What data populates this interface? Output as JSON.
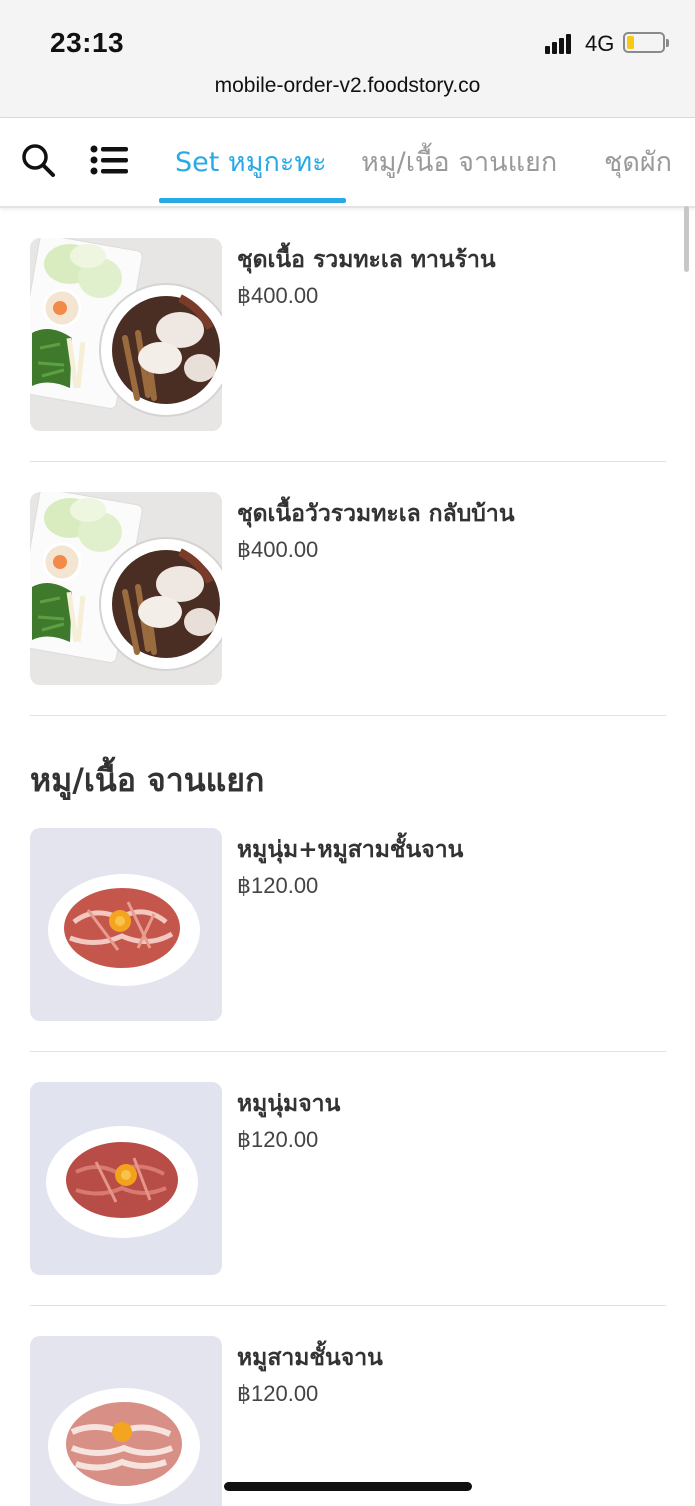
{
  "status": {
    "time": "23:13",
    "network": "4G",
    "battery_level": 0.22
  },
  "browser": {
    "url": "mobile-order-v2.foodstory.co"
  },
  "tabs": [
    {
      "label": "Set หมูกะทะ",
      "active": true
    },
    {
      "label": "หมู/เนื้อ จานแยก",
      "active": false
    },
    {
      "label": "ชุดผัก",
      "active": false
    }
  ],
  "accent_color": "#29a9e6",
  "sections": [
    {
      "title": "",
      "items": [
        {
          "name": "ชุดเนื้อ รวมทะเล ทานร้าน",
          "price": "฿400.00",
          "image": "hotpot-set"
        },
        {
          "name": "ชุดเนื้อวัวรวมทะเล กลับบ้าน",
          "price": "฿400.00",
          "image": "hotpot-set"
        }
      ]
    },
    {
      "title": "หมู/เนื้อ จานแยก",
      "items": [
        {
          "name": "หมูนุ่ม+หมูสามชั้นจาน",
          "price": "฿120.00",
          "image": "pork-plate-mixed"
        },
        {
          "name": "หมูนุ่มจาน",
          "price": "฿120.00",
          "image": "pork-plate-lean"
        },
        {
          "name": "หมูสามชั้นจาน",
          "price": "฿120.00",
          "image": "pork-plate-belly"
        }
      ]
    }
  ]
}
